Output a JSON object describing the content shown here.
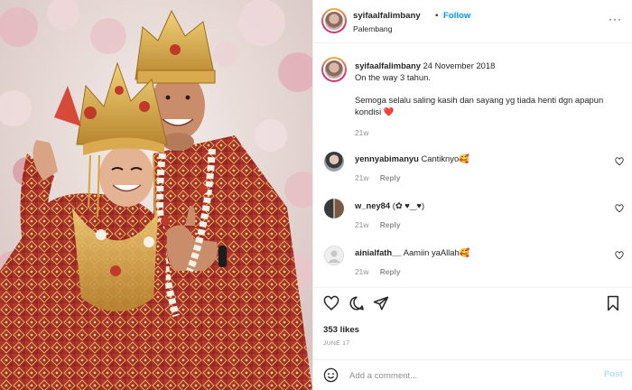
{
  "header": {
    "username": "syifaalfalimbany",
    "separator": "•",
    "follow_label": "Follow",
    "location": "Palembang",
    "more_label": "···"
  },
  "caption": {
    "username": "syifaalfalimbany",
    "date": "24 November 2018",
    "line1": "On the way 3 tahun.",
    "line2": "Semoga selalu saling kasih dan sayang yg tiada henti dgn apapun",
    "line3": "kondisi",
    "line3_emoji": "❤️",
    "age": "21w"
  },
  "comments": [
    {
      "username": "yennyabimanyu",
      "text": "Cantiknyo🥰",
      "age": "21w",
      "reply_label": "Reply"
    },
    {
      "username": "w_ney84",
      "text": "(✿ ♥‿♥)",
      "age": "21w",
      "reply_label": "Reply"
    },
    {
      "username": "ainialfath__",
      "text": "Aamiin yaAllah🥰",
      "age": "21w",
      "reply_label": "Reply"
    }
  ],
  "actions": {
    "likes": "353 likes",
    "date": "JUNE 17"
  },
  "add_comment": {
    "placeholder": "Add a comment...",
    "post_label": "Post"
  },
  "icons": [
    "heart-icon",
    "comment-icon",
    "share-icon",
    "bookmark-icon",
    "emoji-icon",
    "like-comment-icon"
  ],
  "colors": {
    "follow": "#0095f6",
    "post_disabled": "#b2dffc",
    "muted": "#8e8e8e",
    "heart": "#e0245e"
  }
}
